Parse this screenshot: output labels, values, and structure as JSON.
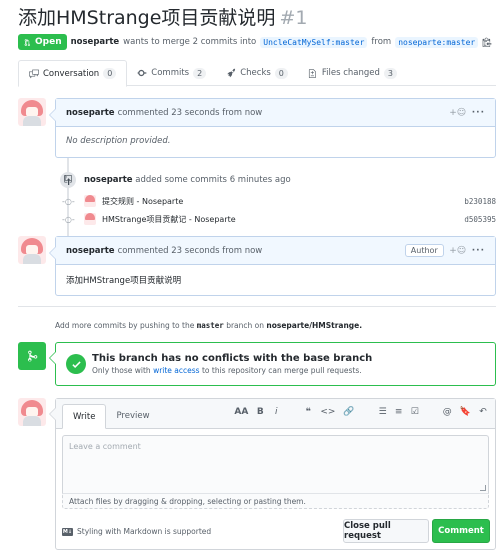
{
  "pr": {
    "title": "添加HMStrange项目贡献说明",
    "number": "#1",
    "state": "Open",
    "author": "noseparte",
    "merge_text": "wants to merge 2 commits into",
    "base_branch": "UncleCatMySelf:master",
    "from_text": "from",
    "head_branch": "noseparte:master"
  },
  "tabs": [
    {
      "label": "Conversation",
      "count": "0"
    },
    {
      "label": "Commits",
      "count": "2"
    },
    {
      "label": "Checks",
      "count": "0"
    },
    {
      "label": "Files changed",
      "count": "3"
    }
  ],
  "comment1": {
    "author": "noseparte",
    "action": "commented 23 seconds from now",
    "body": "No description provided."
  },
  "commits_added": {
    "author": "noseparte",
    "text": "added some commits 6 minutes ago",
    "commits": [
      {
        "message": "提交规则 - Noseparte",
        "sha": "b230188"
      },
      {
        "message": "HMStrange项目贡献记 - Noseparte",
        "sha": "d505395"
      }
    ]
  },
  "comment2": {
    "author": "noseparte",
    "action": "commented 23 seconds from now",
    "badge": "Author",
    "body": "添加HMStrange项目贡献说明"
  },
  "hint": {
    "prefix": "Add more commits by pushing to the",
    "branch": "master",
    "middle": "branch on",
    "repo": "noseparte/HMStrange."
  },
  "merge": {
    "title": "This branch has no conflicts with the base branch",
    "prefix": "Only those with",
    "link": "write access",
    "suffix": "to this repository can merge pull requests."
  },
  "form": {
    "write_tab": "Write",
    "preview_tab": "Preview",
    "placeholder": "Leave a comment",
    "attach": "Attach files by dragging & dropping, selecting or pasting them.",
    "markdown_note": "Styling with Markdown is supported",
    "close_button": "Close pull request",
    "comment_button": "Comment",
    "toolbar": [
      "AA",
      "B",
      "i",
      "❝",
      "<>",
      "🔗",
      "☰",
      "≡",
      "☑",
      "@",
      "🔖",
      "↶"
    ]
  },
  "colors": {
    "green": "#2cbe4e",
    "blue": "#0366d6",
    "comment_header": "#f1f8ff"
  }
}
